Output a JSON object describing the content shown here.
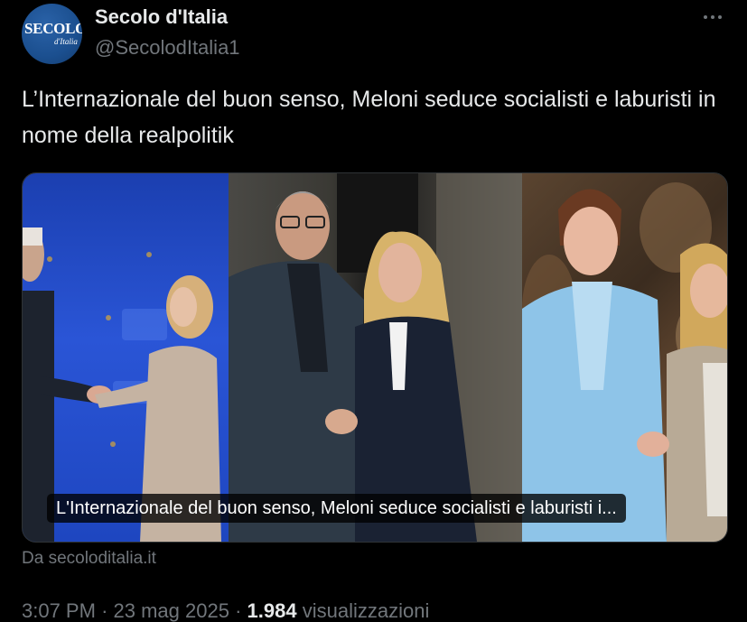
{
  "author": {
    "name": "Secolo d'Italia",
    "handle": "@SecolodItalia1",
    "avatar_text": "SECOLO",
    "avatar_subtext": "d'Italia",
    "avatar_color": "#1b4f8f"
  },
  "more_icon": "more-horizontal-icon",
  "tweet": {
    "text": "L’Internazionale del buon senso, Meloni seduce socialisti e laburisti in nome della realpolitik"
  },
  "card": {
    "caption": "L'Internazionale del buon senso, Meloni seduce socialisti e laburisti i...",
    "source": "Da secoloditalia.it"
  },
  "meta": {
    "time": "3:07 PM",
    "date": "23 mag 2025",
    "separator": "·",
    "views_count": "1.984",
    "views_label": "visualizzazioni"
  },
  "colors": {
    "background": "#000000",
    "text_primary": "#e7e9ea",
    "text_secondary": "#71767b",
    "border": "#2f3336"
  }
}
